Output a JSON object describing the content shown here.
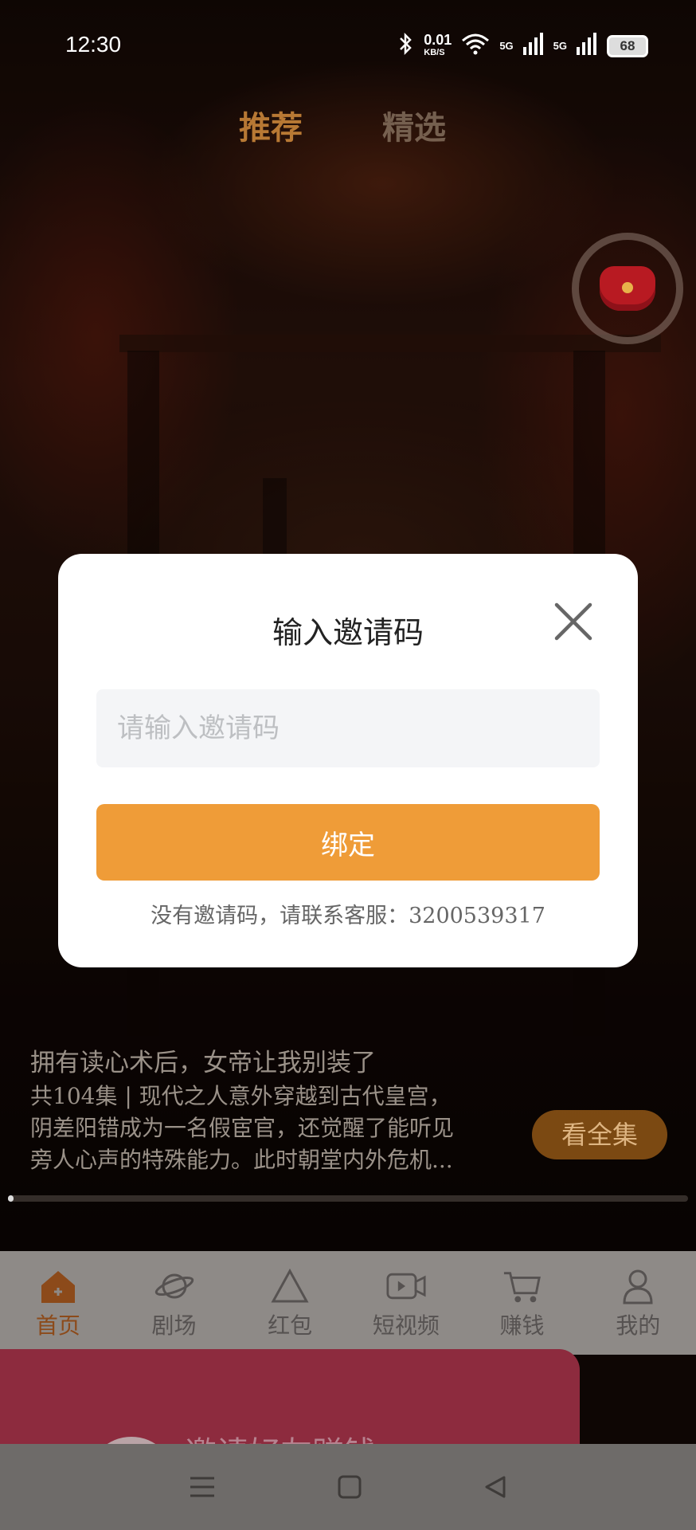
{
  "status_bar": {
    "time": "12:30",
    "speed_value": "0.01",
    "speed_unit": "KB/S",
    "signal_1": "5G",
    "signal_2": "5G",
    "battery": "68"
  },
  "top_tabs": [
    {
      "label": "推荐",
      "selected": true
    },
    {
      "label": "精选",
      "selected": false
    }
  ],
  "drama": {
    "title": "拥有读心术后，女帝让我别装了",
    "description_line1": "共104集 | 现代之人意外穿越到古代皇宫，",
    "description_line2": "阴差阳错成为一名假宦官，还觉醒了能听见",
    "description_line3": "旁人心声的特殊能力。此时朝堂内外危机...",
    "watch_all_label": "看全集",
    "progress_fraction": 0.008
  },
  "bottom_nav": [
    {
      "label": "首页",
      "icon": "home-icon",
      "active": true
    },
    {
      "label": "剧场",
      "icon": "planet-icon",
      "active": false
    },
    {
      "label": "红包",
      "icon": "triangle-icon",
      "active": false
    },
    {
      "label": "短视频",
      "icon": "video-icon",
      "active": false
    },
    {
      "label": "赚钱",
      "icon": "cart-icon",
      "active": false
    },
    {
      "label": "我的",
      "icon": "user-icon",
      "active": false
    }
  ],
  "banner": {
    "text": "邀请好友赚钱"
  },
  "dialog": {
    "title": "输入邀请码",
    "input_placeholder": "请输入邀请码",
    "input_value": "",
    "bind_label": "绑定",
    "hint": "没有邀请码，请联系客服：3200539317"
  },
  "colors": {
    "accent": "#ef9c38",
    "dialog_bg": "#ffffff",
    "input_bg": "#f4f5f7",
    "nav_bg": "#8e8a87",
    "banner_bg": "#8d2b3e"
  }
}
